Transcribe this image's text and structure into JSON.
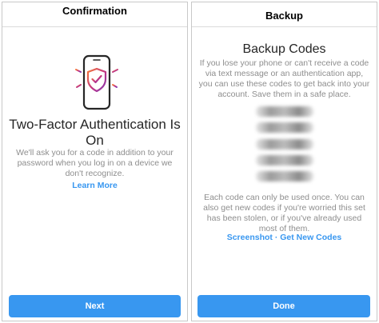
{
  "left": {
    "title": "Confirmation",
    "heading": "Two-Factor Authentication Is On",
    "body": "We'll ask you for a code in addition to your password when you log in on a device we don't recognize.",
    "learn_more": "Learn More",
    "next_button": "Next"
  },
  "right": {
    "title": "Backup",
    "heading": "Backup Codes",
    "intro": "If you lose your phone or can't receive a code via text message or an authentication app, you can use these codes to get back into your account. Save them in a safe place.",
    "note": "Each code can only be used once. You can also get new codes if you're worried this set has been stolen, or if you've already used most of them.",
    "screenshot_link": "Screenshot",
    "separator": "·",
    "new_codes_link": "Get New Codes",
    "done_button": "Done"
  },
  "colors": {
    "accent": "#3897f0",
    "muted_text": "#8e8e8e",
    "shield_gradient": [
      "#f77737",
      "#c13584",
      "#833ab4"
    ]
  }
}
